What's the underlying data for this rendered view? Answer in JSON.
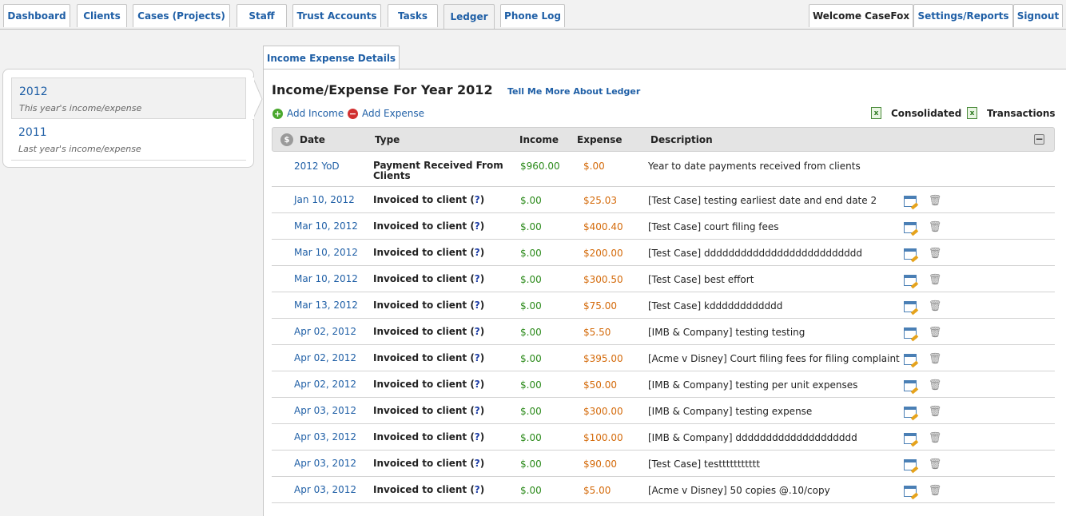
{
  "nav": {
    "tabs": [
      {
        "label": "Dashboard"
      },
      {
        "label": "Clients"
      },
      {
        "label": "Cases (Projects)"
      },
      {
        "label": "Staff"
      },
      {
        "label": "Trust Accounts"
      },
      {
        "label": "Tasks"
      },
      {
        "label": "Ledger"
      },
      {
        "label": "Phone Log"
      }
    ],
    "welcome": "Welcome CaseFox",
    "settings": "Settings/Reports",
    "signout": "Signout"
  },
  "years": [
    {
      "year": "2012",
      "subtitle": "This year's income/expense"
    },
    {
      "year": "2011",
      "subtitle": "Last year's income/expense"
    }
  ],
  "section_tab": "Income Expense Details",
  "header": {
    "title": "Income/Expense For Year 2012",
    "tell_link": "Tell Me More About Ledger",
    "add_income": "Add Income",
    "add_expense": "Add Expense",
    "consolidated": "Consolidated",
    "transactions": "Transactions"
  },
  "columns": {
    "date": "Date",
    "type": "Type",
    "income": "Income",
    "expense": "Expense",
    "description": "Description"
  },
  "summary": {
    "date": "2012 YoD",
    "type": "Payment Received From Clients",
    "income": "$960.00",
    "expense": "$.00",
    "description": "Year to date payments received from clients"
  },
  "rows": [
    {
      "date": "Jan 10, 2012",
      "type": "Invoiced to client",
      "help": "?",
      "income": "$.00",
      "expense": "$25.03",
      "description": "[Test Case] testing earliest date and end date 2"
    },
    {
      "date": "Mar 10, 2012",
      "type": "Invoiced to client",
      "help": "?",
      "income": "$.00",
      "expense": "$400.40",
      "description": "[Test Case] court filing fees"
    },
    {
      "date": "Mar 10, 2012",
      "type": "Invoiced to client",
      "help": "?",
      "income": "$.00",
      "expense": "$200.00",
      "description": "[Test Case] dddddddddddddddddddddddddd"
    },
    {
      "date": "Mar 10, 2012",
      "type": "Invoiced to client",
      "help": "?",
      "income": "$.00",
      "expense": "$300.50",
      "description": "[Test Case] best effort"
    },
    {
      "date": "Mar 13, 2012",
      "type": "Invoiced to client",
      "help": "?",
      "income": "$.00",
      "expense": "$75.00",
      "description": "[Test Case] kdddddddddddd"
    },
    {
      "date": "Apr 02, 2012",
      "type": "Invoiced to client",
      "help": "?",
      "income": "$.00",
      "expense": "$5.50",
      "description": "[IMB & Company] testing testing"
    },
    {
      "date": "Apr 02, 2012",
      "type": "Invoiced to client",
      "help": "?",
      "income": "$.00",
      "expense": "$395.00",
      "description": "[Acme v Disney] Court filing fees for filing complaint"
    },
    {
      "date": "Apr 02, 2012",
      "type": "Invoiced to client",
      "help": "?",
      "income": "$.00",
      "expense": "$50.00",
      "description": "[IMB & Company] testing per unit expenses"
    },
    {
      "date": "Apr 03, 2012",
      "type": "Invoiced to client",
      "help": "?",
      "income": "$.00",
      "expense": "$300.00",
      "description": "[IMB & Company] testing expense"
    },
    {
      "date": "Apr 03, 2012",
      "type": "Invoiced to client",
      "help": "?",
      "income": "$.00",
      "expense": "$100.00",
      "description": "[IMB & Company] dddddddddddddddddddd"
    },
    {
      "date": "Apr 03, 2012",
      "type": "Invoiced to client",
      "help": "?",
      "income": "$.00",
      "expense": "$90.00",
      "description": "[Test Case] testtttttttttt"
    },
    {
      "date": "Apr 03, 2012",
      "type": "Invoiced to client",
      "help": "?",
      "income": "$.00",
      "expense": "$5.00",
      "description": "[Acme v Disney] 50 copies @.10/copy"
    }
  ]
}
